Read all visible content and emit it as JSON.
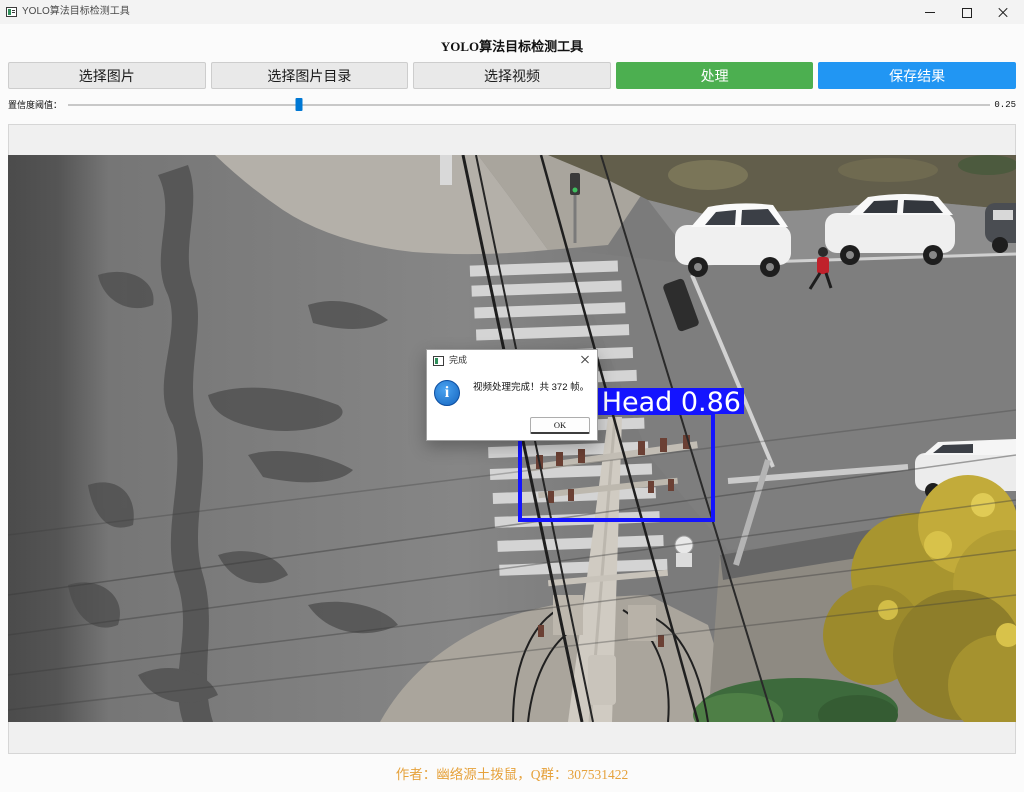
{
  "window": {
    "title": "YOLO算法目标检测工具",
    "app_icon": "window-icon",
    "minimize_icon": "minimize-icon",
    "maximize_icon": "maximize-icon",
    "close_icon": "close-icon"
  },
  "header": {
    "title": "YOLO算法目标检测工具"
  },
  "toolbar": {
    "select_image": "选择图片",
    "select_image_dir": "选择图片目录",
    "select_video": "选择视频",
    "process": "处理",
    "save_results": "保存结果"
  },
  "confidence": {
    "label": "置信度阈值：",
    "value_text": "0.25",
    "level": 0.25
  },
  "preview": {
    "detections": [
      {
        "label": "Head 0.86"
      }
    ]
  },
  "footer": {
    "text": "作者：幽络源土拨鼠，Q群：307531422"
  },
  "dialog": {
    "title": "完成",
    "icon": "info-icon",
    "close_icon": "close-icon",
    "message": "视频处理完成！共 372 帧。",
    "ok_label": "OK"
  },
  "colors": {
    "process_button": "#4CAF50",
    "save_button": "#2196F3",
    "slider_handle": "#0078D4",
    "footer_text": "#E6A23C",
    "detection": "#1414FF"
  }
}
